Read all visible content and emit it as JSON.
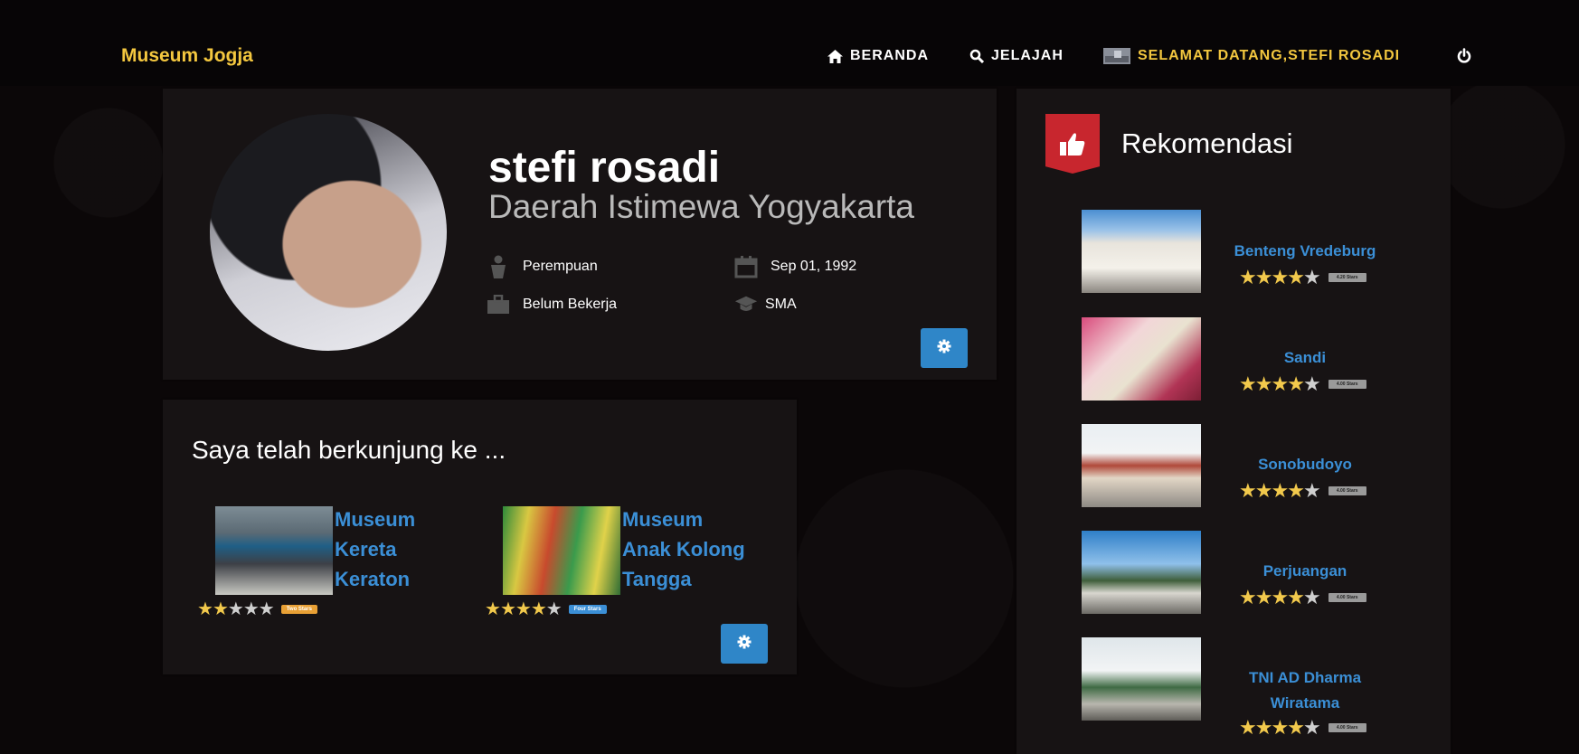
{
  "nav": {
    "brand": "Museum Jogja",
    "beranda": "BERANDA",
    "jelajah": "JELAJAH",
    "user": "SELAMAT DATANG,STEFI ROSADI"
  },
  "profile": {
    "name": "stefi rosadi",
    "region": "Daerah Istimewa Yogyakarta",
    "gender": "Perempuan",
    "birthdate": "Sep 01, 1992",
    "job": "Belum Bekerja",
    "education": "SMA"
  },
  "visited": {
    "title": "Saya telah berkunjung ke ...",
    "items": [
      {
        "name_lines": [
          "Museum",
          "Kereta",
          "Keraton"
        ],
        "rating": 2,
        "max": 5,
        "badge": "Two Stars",
        "badge_color": "#e8a035"
      },
      {
        "name_lines": [
          "Museum",
          "Anak Kolong",
          "Tangga"
        ],
        "rating": 4,
        "max": 5,
        "badge": "Four Stars",
        "badge_color": "#3b8fd6"
      }
    ]
  },
  "recommend": {
    "title": "Rekomendasi",
    "items": [
      {
        "name_lines": [
          "Benteng Vredeburg"
        ],
        "rating": 4,
        "max": 5,
        "badge": "4.20 Stars"
      },
      {
        "name_lines": [
          "Sandi"
        ],
        "rating": 4,
        "max": 5,
        "badge": "4.00 Stars"
      },
      {
        "name_lines": [
          "Sonobudoyo"
        ],
        "rating": 4,
        "max": 5,
        "badge": "4.00 Stars"
      },
      {
        "name_lines": [
          "Perjuangan"
        ],
        "rating": 4,
        "max": 5,
        "badge": "4.00 Stars"
      },
      {
        "name_lines": [
          "TNI AD Dharma",
          "Wiratama"
        ],
        "rating": 4,
        "max": 5,
        "badge": "4.00 Stars"
      }
    ]
  },
  "colors": {
    "accent": "#f3c73f",
    "link": "#3b8fd6",
    "button": "#2f86c8",
    "ribbon": "#c8262e"
  },
  "icons": [
    "home-icon",
    "search-icon",
    "user-photo-icon",
    "power-icon",
    "gender-icon",
    "calendar-icon",
    "briefcase-icon",
    "graduation-cap-icon",
    "gear-icon",
    "thumbs-up-icon"
  ]
}
